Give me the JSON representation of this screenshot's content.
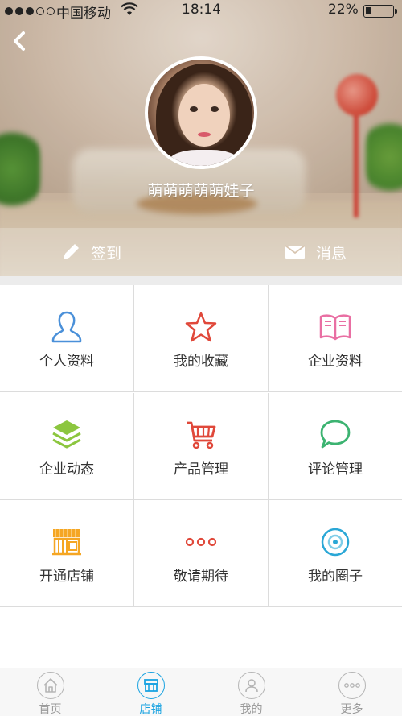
{
  "status_bar": {
    "carrier": "中国移动",
    "time": "18:14",
    "battery": "22%"
  },
  "profile": {
    "username": "萌萌萌萌萌娃子"
  },
  "actions": {
    "checkin_label": "签到",
    "message_label": "消息"
  },
  "menu": {
    "items": [
      {
        "label": "个人资料",
        "icon": "person-icon",
        "color": "#4a90d9"
      },
      {
        "label": "我的收藏",
        "icon": "star-icon",
        "color": "#e0483a"
      },
      {
        "label": "企业资料",
        "icon": "book-icon",
        "color": "#e96fa3"
      },
      {
        "label": "企业动态",
        "icon": "layers-icon",
        "color": "#8cc63f"
      },
      {
        "label": "产品管理",
        "icon": "cart-icon",
        "color": "#e0483a"
      },
      {
        "label": "评论管理",
        "icon": "chat-bubble-icon",
        "color": "#3cb371"
      },
      {
        "label": "开通店铺",
        "icon": "store-icon",
        "color": "#f5a623"
      },
      {
        "label": "敬请期待",
        "icon": "more-dots-icon",
        "color": "#e0483a"
      },
      {
        "label": "我的圈子",
        "icon": "circle-target-icon",
        "color": "#2aa7d6"
      }
    ]
  },
  "tabbar": {
    "items": [
      {
        "label": "首页",
        "icon": "home-icon",
        "active": false
      },
      {
        "label": "店铺",
        "icon": "shop-icon",
        "active": true
      },
      {
        "label": "我的",
        "icon": "user-icon",
        "active": false
      },
      {
        "label": "更多",
        "icon": "more-icon",
        "active": false
      }
    ],
    "active_color": "#1aa3e1",
    "inactive_color": "#9a9a9a"
  }
}
